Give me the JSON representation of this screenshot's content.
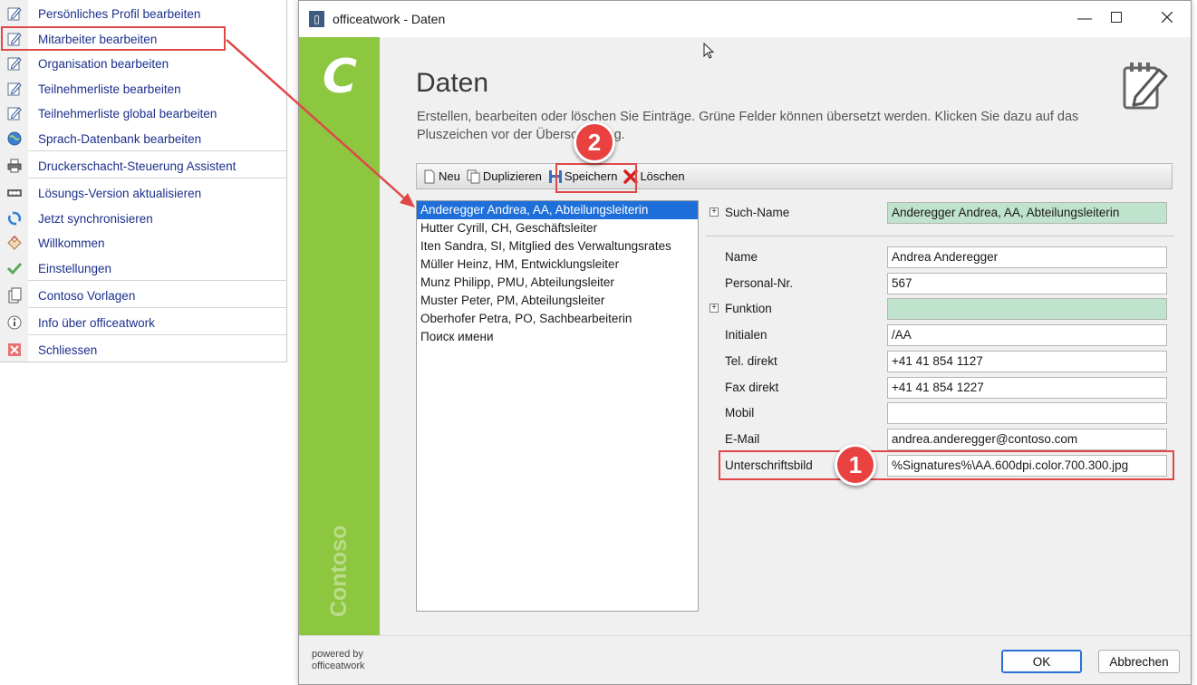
{
  "menu": {
    "items": [
      {
        "label": "Persönliches Profil bearbeiten",
        "icon": "edit-icon"
      },
      {
        "label": "Mitarbeiter bearbeiten",
        "icon": "edit-icon"
      },
      {
        "label": "Organisation bearbeiten",
        "icon": "edit-icon"
      },
      {
        "label": "Teilnehmerliste bearbeiten",
        "icon": "edit-icon"
      },
      {
        "label": "Teilnehmerliste global bearbeiten",
        "icon": "edit-icon"
      },
      {
        "label": "Sprach-Datenbank bearbeiten",
        "icon": "globe-icon"
      },
      {
        "label": "Druckerschacht-Steuerung Assistent",
        "icon": "printer-icon"
      },
      {
        "label": "Lösungs-Version aktualisieren",
        "icon": "update-icon"
      },
      {
        "label": "Jetzt synchronisieren",
        "icon": "sync-icon"
      },
      {
        "label": "Willkommen",
        "icon": "welcome-icon"
      },
      {
        "label": "Einstellungen",
        "icon": "checkmark-icon"
      },
      {
        "label": "Contoso Vorlagen",
        "icon": "template-icon"
      },
      {
        "label": "Info über officeatwork",
        "icon": "info-icon"
      },
      {
        "label": "Schliessen",
        "icon": "close-icon"
      }
    ]
  },
  "window": {
    "title": "officeatwork - Daten",
    "logo_letter": "C",
    "brand_vertical": "Contoso",
    "page_title": "Daten",
    "description": "Erstellen, bearbeiten oder löschen Sie Einträge. Grüne Felder können übersetzt werden. Klicken Sie dazu auf das Pluszeichen vor der Überschriftung.",
    "toolbar": {
      "new": "Neu",
      "duplicate": "Duplizieren",
      "save": "Speichern",
      "delete": "Löschen"
    },
    "list": [
      "Anderegger Andrea, AA, Abteilungsleiterin",
      "Hutter Cyrill, CH, Geschäftsleiter",
      "Iten Sandra, SI, Mitglied des Verwaltungsrates",
      "Müller Heinz, HM, Entwicklungsleiter",
      "Munz Philipp, PMU, Abteilungsleiter",
      "Muster Peter, PM, Abteilungsleiter",
      "Oberhofer Petra, PO, Sachbearbeiterin",
      "Поиск имени"
    ],
    "form": {
      "search_name": {
        "label": "Such-Name",
        "value": "Anderegger Andrea, AA, Abteilungsleiterin"
      },
      "name": {
        "label": "Name",
        "value": "Andrea Anderegger"
      },
      "personal_nr": {
        "label": "Personal-Nr.",
        "value": "567"
      },
      "funktion": {
        "label": "Funktion",
        "value": ""
      },
      "initialen": {
        "label": "Initialen",
        "value": "/AA"
      },
      "tel_direkt": {
        "label": "Tel. direkt",
        "value": "+41 41 854 1127"
      },
      "fax_direkt": {
        "label": "Fax direkt",
        "value": "+41 41 854 1227"
      },
      "mobil": {
        "label": "Mobil",
        "value": ""
      },
      "email": {
        "label": "E-Mail",
        "value": "andrea.anderegger@contoso.com"
      },
      "unterschriftsbild": {
        "label": "Unterschriftsbild",
        "value": "%Signatures%\\AA.600dpi.color.700.300.jpg"
      }
    },
    "powered_line1": "powered by",
    "powered_line2": "officeatwork",
    "ok": "OK",
    "cancel": "Abbrechen"
  },
  "callouts": {
    "one": "1",
    "two": "2"
  },
  "colors": {
    "green_sidebar": "#8dc63f",
    "translatable_field": "#bfe3cc",
    "selection": "#1e6fd9",
    "callout_red": "#e8413f",
    "menu_text": "#1b2f8c"
  }
}
